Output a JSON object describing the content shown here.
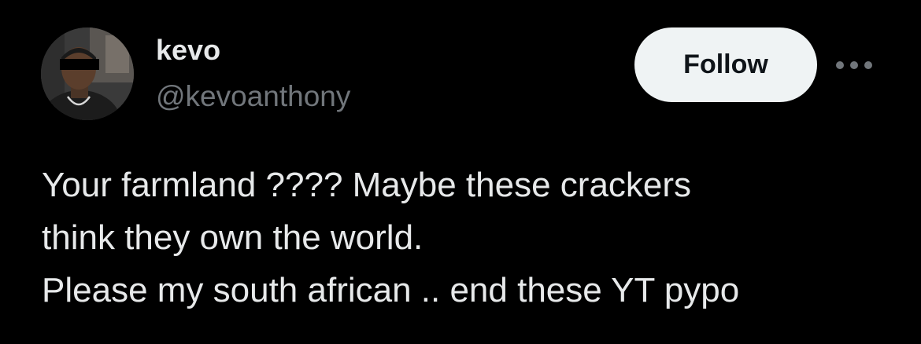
{
  "author": {
    "display_name": "kevo",
    "handle": "@kevoanthony",
    "avatar_icon": "profile-photo"
  },
  "actions": {
    "follow_label": "Follow",
    "more_icon": "more-horizontal-icon"
  },
  "tweet": {
    "lines": [
      "Your farmland ???? Maybe these crackers",
      "think they own the world.",
      "Please my south african .. end these YT pypo"
    ]
  },
  "colors": {
    "background": "#000000",
    "primary_text": "#e7e9ea",
    "secondary_text": "#71767b",
    "follow_button_bg": "#eff3f4",
    "follow_button_text": "#0f1419"
  }
}
